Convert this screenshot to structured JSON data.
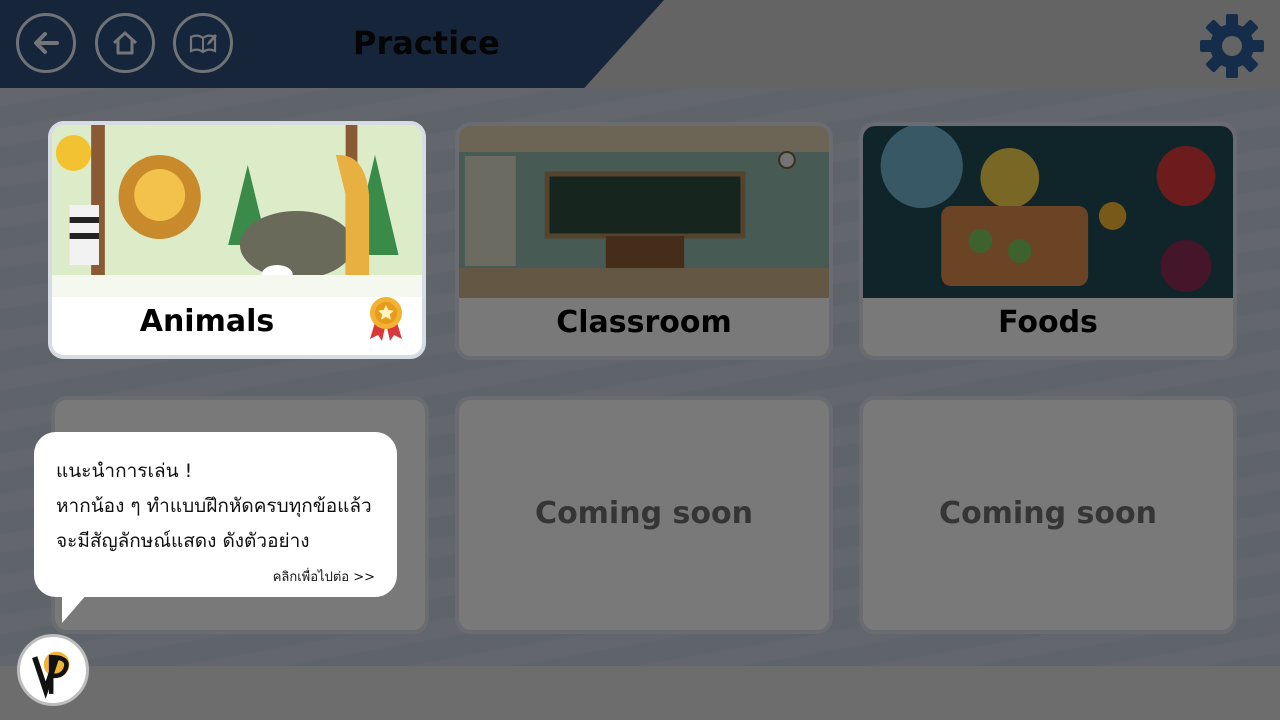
{
  "header": {
    "title": "Practice",
    "back_icon": "arrow-left-icon",
    "home_icon": "home-icon",
    "book_icon": "book-edit-icon",
    "settings_icon": "gear-icon"
  },
  "cards": [
    {
      "label": "Animals",
      "badge": "award-ribbon-icon"
    },
    {
      "label": "Classroom"
    },
    {
      "label": "Foods"
    },
    {
      "label": ""
    },
    {
      "label": "Coming soon"
    },
    {
      "label": "Coming soon"
    }
  ],
  "tooltip": {
    "line1": "แนะนำการเล่น !",
    "line2": "หากน้อง ๆ ทำแบบฝึกหัดครบทุกข้อแล้ว",
    "line3": "จะมีสัญลักษณ์แสดง ดังตัวอย่าง",
    "next": "คลิกเพื่อไปต่อ >>"
  },
  "colors": {
    "header_blue": "#2e4a74",
    "accent_gold": "#f2b233",
    "ribbon_red": "#d9393b"
  }
}
